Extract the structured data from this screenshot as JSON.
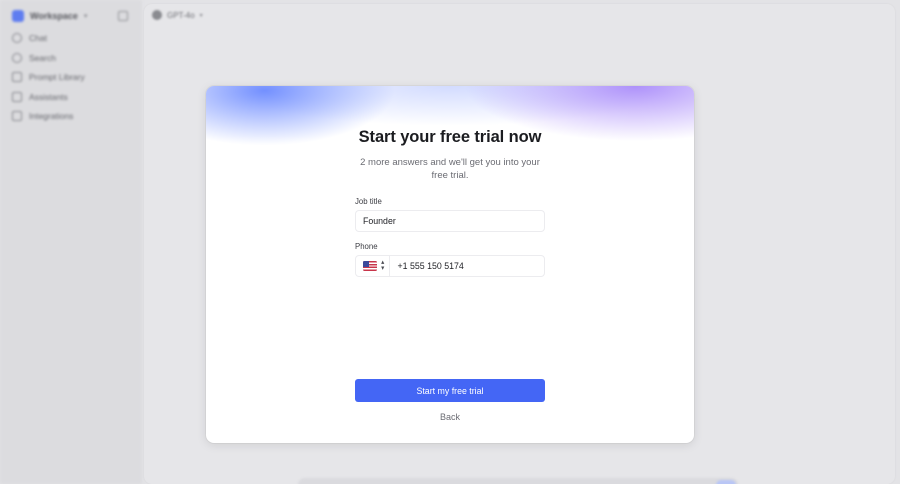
{
  "sidebar": {
    "workspace_name": "Workspace",
    "items": [
      {
        "label": "Chat",
        "icon": "chat-icon"
      },
      {
        "label": "Search",
        "icon": "search-icon"
      },
      {
        "label": "Prompt Library",
        "icon": "library-icon"
      },
      {
        "label": "Assistants",
        "icon": "assistants-icon"
      },
      {
        "label": "Integrations",
        "icon": "integrations-icon"
      }
    ]
  },
  "header": {
    "model_name": "GPT-4o"
  },
  "modal": {
    "title": "Start your free trial now",
    "subtitle": "2 more answers and we'll get you into your free trial.",
    "job_title": {
      "label": "Job title",
      "value": "Founder"
    },
    "phone": {
      "label": "Phone",
      "country_flag": "us-flag-icon",
      "value": "+1 555 150 5174"
    },
    "submit_label": "Start my free trial",
    "back_label": "Back"
  },
  "colors": {
    "accent": "#4466f5",
    "background": "#e3e3e6",
    "modal_background": "#ffffff"
  }
}
